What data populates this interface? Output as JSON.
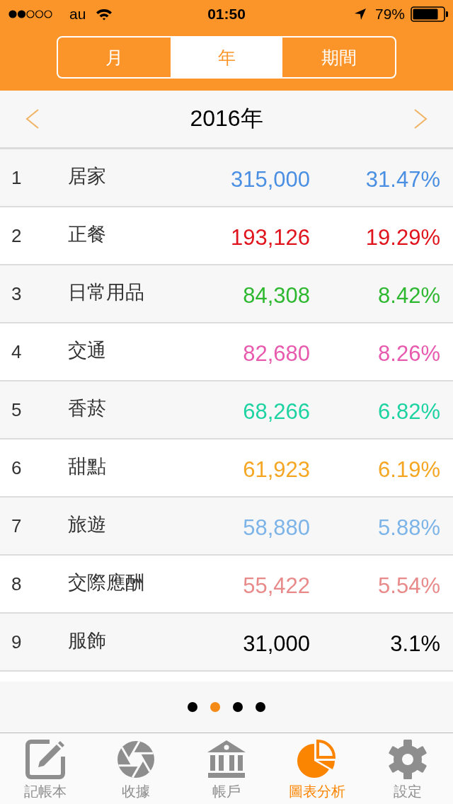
{
  "status_bar": {
    "carrier": "au",
    "time": "01:50",
    "battery": "79%"
  },
  "segments": [
    {
      "label": "月",
      "selected": false
    },
    {
      "label": "年",
      "selected": true
    },
    {
      "label": "期間",
      "selected": false
    }
  ],
  "period": {
    "label": "2016年"
  },
  "rows": [
    {
      "rank": "1",
      "category": "居家",
      "amount": "315,000",
      "percent": "31.47%",
      "color": "#4a8fe2"
    },
    {
      "rank": "2",
      "category": "正餐",
      "amount": "193,126",
      "percent": "19.29%",
      "color": "#e0141c"
    },
    {
      "rank": "3",
      "category": "日常用品",
      "amount": "84,308",
      "percent": "8.42%",
      "color": "#2eb830"
    },
    {
      "rank": "4",
      "category": "交通",
      "amount": "82,680",
      "percent": "8.26%",
      "color": "#e85aae"
    },
    {
      "rank": "5",
      "category": "香菸",
      "amount": "68,266",
      "percent": "6.82%",
      "color": "#1ed3a2"
    },
    {
      "rank": "6",
      "category": "甜點",
      "amount": "61,923",
      "percent": "6.19%",
      "color": "#f5a623"
    },
    {
      "rank": "7",
      "category": "旅遊",
      "amount": "58,880",
      "percent": "5.88%",
      "color": "#7db4e8"
    },
    {
      "rank": "8",
      "category": "交際應酬",
      "amount": "55,422",
      "percent": "5.54%",
      "color": "#e88a8a"
    },
    {
      "rank": "9",
      "category": "服飾",
      "amount": "31,000",
      "percent": "3.1%",
      "color": "#000000"
    }
  ],
  "pager": [
    {
      "selected": false
    },
    {
      "selected": true
    },
    {
      "selected": false
    },
    {
      "selected": false
    }
  ],
  "tab_bar": [
    {
      "label": "記帳本",
      "selected": false
    },
    {
      "label": "收據",
      "selected": false
    },
    {
      "label": "帳戶",
      "selected": false
    },
    {
      "label": "圖表分析",
      "selected": true
    },
    {
      "label": "設定",
      "selected": false
    }
  ]
}
